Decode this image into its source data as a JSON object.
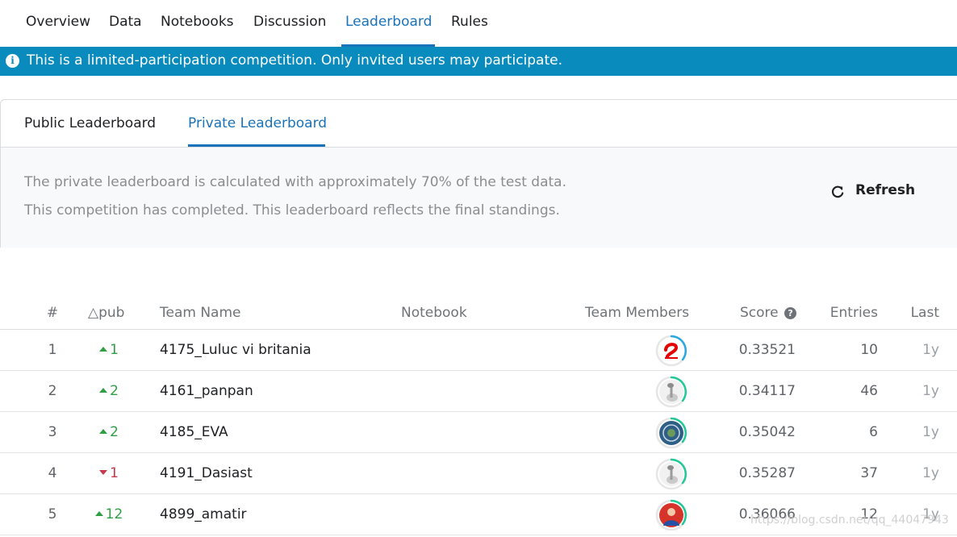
{
  "nav": {
    "tabs": [
      "Overview",
      "Data",
      "Notebooks",
      "Discussion",
      "Leaderboard",
      "Rules"
    ],
    "active": "Leaderboard"
  },
  "banner": {
    "icon": "info-icon",
    "text": "This is a limited-participation competition. Only invited users may participate."
  },
  "leaderboard_tabs": {
    "public": "Public Leaderboard",
    "private": "Private Leaderboard",
    "active": "Private Leaderboard"
  },
  "info": {
    "line1": "The private leaderboard is calculated with approximately 70% of the test data.",
    "line2": "This competition has completed. This leaderboard reflects the final standings."
  },
  "refresh": {
    "label": "Refresh",
    "icon": "refresh-icon"
  },
  "table": {
    "headers": {
      "rank": "#",
      "delta": "△pub",
      "team": "Team Name",
      "notebook": "Notebook",
      "members": "Team Members",
      "score": "Score",
      "entries": "Entries",
      "last": "Last"
    },
    "rows": [
      {
        "rank": "1",
        "delta": "1",
        "direction": "up",
        "team": "4175_Luluc vi britania",
        "score": "0.33521",
        "entries": "10",
        "last": "1y",
        "avatar": "airtel-logo-avatar",
        "ring": "#29a8e0"
      },
      {
        "rank": "2",
        "delta": "2",
        "direction": "up",
        "team": "4161_panpan",
        "score": "0.34117",
        "entries": "46",
        "last": "1y",
        "avatar": "ostrich-avatar",
        "ring": "#20c997"
      },
      {
        "rank": "3",
        "delta": "2",
        "direction": "up",
        "team": "4185_EVA",
        "score": "0.35042",
        "entries": "6",
        "last": "1y",
        "avatar": "emblem-avatar",
        "ring": "#20c997"
      },
      {
        "rank": "4",
        "delta": "1",
        "direction": "down",
        "team": "4191_Dasiast",
        "score": "0.35287",
        "entries": "37",
        "last": "1y",
        "avatar": "ostrich-avatar",
        "ring": "#20c997"
      },
      {
        "rank": "5",
        "delta": "12",
        "direction": "up",
        "team": "4899_amatir",
        "score": "0.36066",
        "entries": "12",
        "last": "1y",
        "avatar": "person-photo-avatar",
        "ring": "#20c997"
      }
    ]
  },
  "colors": {
    "accent": "#1a73b8",
    "banner": "#0a8bbd",
    "up": "#2f9e44",
    "down": "#c6384a"
  },
  "watermark": "https://blog.csdn.net/qq_44047943"
}
